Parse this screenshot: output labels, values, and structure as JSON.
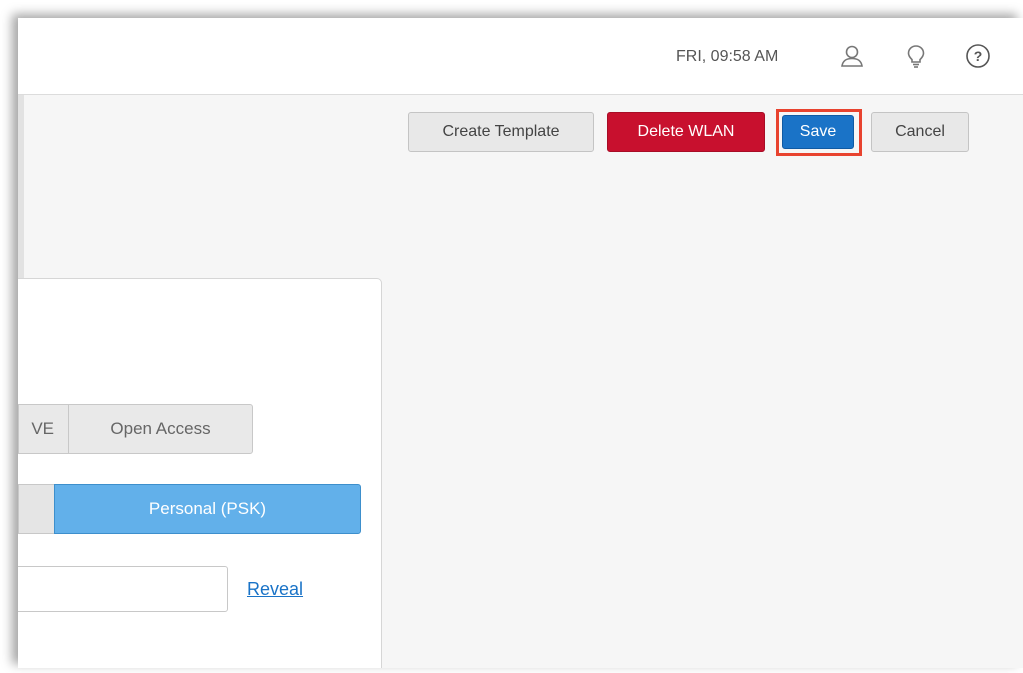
{
  "header": {
    "datetime": "FRI, 09:58 AM",
    "icons": [
      "user-icon",
      "lightbulb-icon",
      "help-icon"
    ]
  },
  "toolbar": {
    "create_template_label": "Create Template",
    "delete_wlan_label": "Delete WLAN",
    "save_label": "Save",
    "cancel_label": "Cancel"
  },
  "security": {
    "type_options_visible": [
      "WE",
      "Open Access"
    ],
    "owe_partial_label": "VE",
    "open_access_label": "Open Access",
    "key_mode_selected": "Personal (PSK)",
    "passphrase_value": "",
    "reveal_label": "Reveal"
  },
  "colors": {
    "delete": "#c8102e",
    "save": "#1a73c7",
    "save_highlight": "#e8432f",
    "psk_selected": "#62b0ea"
  }
}
